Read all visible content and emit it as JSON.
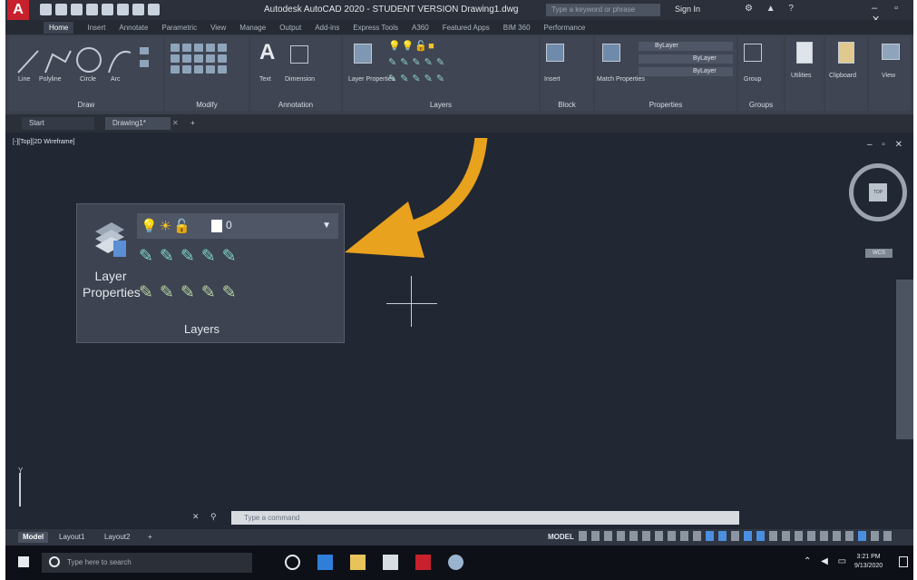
{
  "window": {
    "logo": "A",
    "title": "Autodesk AutoCAD 2020 - STUDENT VERSION   Drawing1.dwg",
    "search_placeholder": "Type a keyword or phrase",
    "signin_label": "Sign In"
  },
  "ribbon_tabs": [
    "Home",
    "Insert",
    "Annotate",
    "Parametric",
    "View",
    "Manage",
    "Output",
    "Add-ins",
    "Express Tools",
    "A360",
    "Featured Apps",
    "BIM 360",
    "Performance"
  ],
  "ribbon": {
    "draw": {
      "label": "Draw",
      "tools": [
        "Line",
        "Polyline",
        "Circle",
        "Arc"
      ]
    },
    "modify": {
      "label": "Modify"
    },
    "annotation": {
      "label": "Annotation",
      "tools": [
        "Text",
        "Dimension"
      ]
    },
    "layers": {
      "label": "Layers",
      "tool": "Layer Properties"
    },
    "block": {
      "label": "Block",
      "tool": "Insert"
    },
    "properties": {
      "label": "Properties",
      "tool": "Match Properties",
      "color": "ByLayer",
      "linetype": "ByLayer",
      "lineweight": "ByLayer"
    },
    "groups": {
      "label": "Groups",
      "tool": "Group"
    },
    "utilities": {
      "label": "Utilities"
    },
    "clipboard": {
      "label": "Clipboard"
    },
    "view": {
      "label": "View"
    }
  },
  "file_tabs": {
    "start": "Start",
    "drawing": "Drawing1*"
  },
  "viewport": {
    "label": "[-][Top][2D Wireframe]",
    "wcs": "WCS",
    "viewcube_face": "TOP"
  },
  "layers_zoom": {
    "tool_label": "Layer Properties",
    "layer_name": "0",
    "panel_label": "Layers"
  },
  "command_line": {
    "placeholder": "Type a command"
  },
  "layout_tabs": [
    "Model",
    "Layout1",
    "Layout2"
  ],
  "status": {
    "mode": "MODEL"
  },
  "taskbar": {
    "search_placeholder": "Type here to search",
    "time": "3:21 PM",
    "date": "9/13/2020"
  },
  "colors": {
    "arrow": "#e8a21d",
    "app_red": "#c8202c",
    "drawing_bg": "#212733"
  }
}
